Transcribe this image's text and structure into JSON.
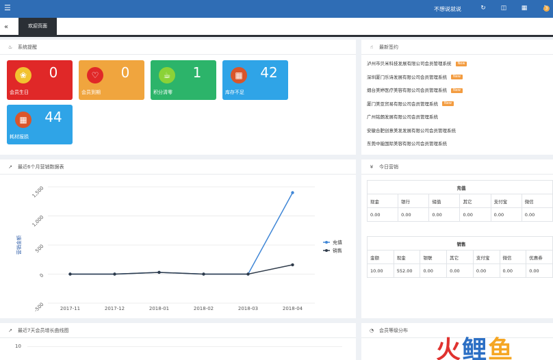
{
  "topbar": {
    "menu_icon": "menu-icon",
    "favorite_label": "不想说就说",
    "notification_count": "3"
  },
  "tabbar": {
    "back_label": "«",
    "active_tab": "欢迎页面"
  },
  "system_alerts": {
    "title": "系统提醒",
    "tiles": [
      {
        "label": "会员生日",
        "value": "0",
        "icon": "cake-icon",
        "color": "#e02828",
        "circle": "#f2c230"
      },
      {
        "label": "会员到期",
        "value": "0",
        "icon": "heart-icon",
        "color": "#f0a53e",
        "circle": "#e02828"
      },
      {
        "label": "积分清零",
        "value": "1",
        "icon": "cup-icon",
        "color": "#2cb46a",
        "circle": "#8bd237"
      },
      {
        "label": "库存不足",
        "value": "42",
        "icon": "box-icon",
        "color": "#2fa4e7",
        "circle": "#d9552b"
      },
      {
        "label": "耗材报损",
        "value": "44",
        "icon": "box-icon",
        "color": "#2fa4e7",
        "circle": "#d9552b"
      }
    ]
  },
  "latest_news": {
    "title": "最新签约",
    "items": [
      {
        "text": "泸州市贝米科技发展有限公司会员管理系统",
        "hot": true
      },
      {
        "text": "深圳厦门乐诗发展有限公司会员管理系统",
        "hot": true
      },
      {
        "text": "烟台美婷医疗美容有限公司会员管理系统",
        "hot": true
      },
      {
        "text": "厦门美亚贸易有限公司会员管理系统",
        "hot": true
      },
      {
        "text": "广州铭朗发展有限公司会员管理系统",
        "hot": false
      },
      {
        "text": "安徽合肥创意美发发展有限公司会员管理系统",
        "hot": false
      },
      {
        "text": "东莞中能国际美容有限公司会员管理系统",
        "hot": false
      }
    ],
    "hot_label": "New"
  },
  "sales_chart": {
    "title": "最近6个月营销数据表",
    "chart_data": {
      "type": "line",
      "x": [
        "2017-11",
        "2017-12",
        "2018-01",
        "2018-02",
        "2018-03",
        "2018-04"
      ],
      "series": [
        {
          "name": "充值",
          "color": "#3f86d6",
          "values": [
            0,
            0,
            30,
            0,
            0,
            1400
          ]
        },
        {
          "name": "销售",
          "color": "#2f3b4a",
          "values": [
            0,
            0,
            30,
            0,
            0,
            160
          ]
        }
      ],
      "ylabel": "营销金额",
      "y_ticks": [
        "-500",
        "0",
        "500",
        "1,000",
        "1,500"
      ],
      "ylim": [
        -500,
        1500
      ],
      "legend": "right"
    }
  },
  "today": {
    "title": "今日营销",
    "recharge": {
      "title": "充值",
      "headers": [
        "现金",
        "银行",
        "储值",
        "其它",
        "支付宝",
        "微信"
      ],
      "values": [
        "0.00",
        "0.00",
        "0.00",
        "0.00",
        "0.00",
        "0.00"
      ]
    },
    "sales": {
      "title": "销售",
      "headers": [
        "金额",
        "现金",
        "银联",
        "其它",
        "支付宝",
        "微信",
        "优惠券"
      ],
      "values": [
        "10.00",
        "552.00",
        "0.00",
        "0.00",
        "0.00",
        "0.00",
        "0.00"
      ]
    }
  },
  "member_growth": {
    "title": "最近7天会员增长曲线图",
    "first_tick": "10"
  },
  "member_level": {
    "title": "会员等级分布"
  },
  "watermark": {
    "parts": [
      "火",
      "鲤",
      "鱼"
    ],
    "colors": [
      "#e0322f",
      "#2c6fc4",
      "#f5a623"
    ]
  }
}
